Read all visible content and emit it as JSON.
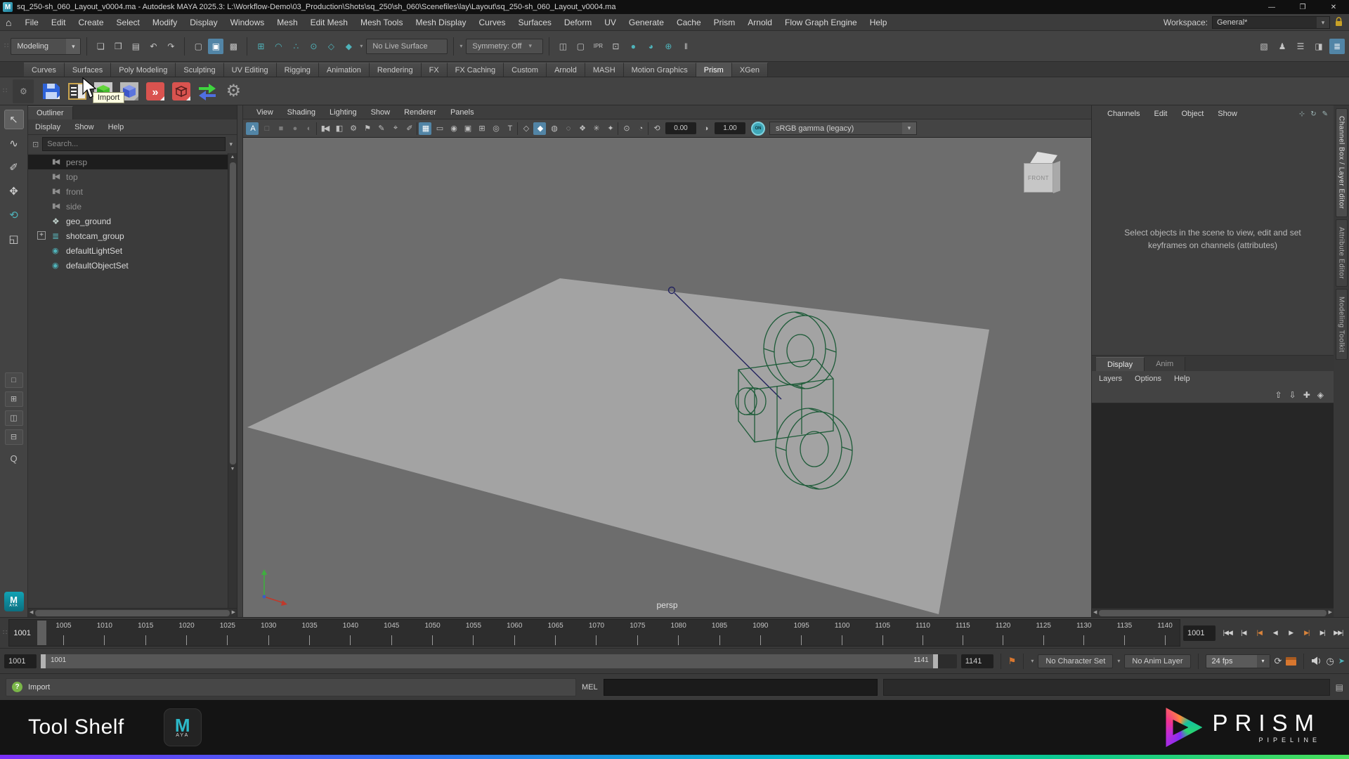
{
  "window": {
    "app_letter": "M",
    "title": "sq_250-sh_060_Layout_v0004.ma - Autodesk MAYA 2025.3: L:\\Workflow-Demo\\03_Production\\Shots\\sq_250\\sh_060\\Scenefiles\\lay\\Layout\\sq_250-sh_060_Layout_v0004.ma",
    "controls": {
      "minimize": "—",
      "maximize": "❐",
      "close": "✕"
    }
  },
  "glyphs": {
    "home": "⌂",
    "chevron_down": "▾",
    "handle": "∷",
    "gear": "⚙",
    "left_arrow": "◀",
    "right_arrow": "▶",
    "up_arrow": "▲",
    "down_arrow": "▼",
    "search_box": "⊡",
    "plus": "+",
    "question": "?",
    "bookmark": "⚑",
    "loop": "⟳",
    "clock": "◷",
    "run": "➤",
    "script": "▤",
    "lock": "lock"
  },
  "menubar": {
    "items": [
      "File",
      "Edit",
      "Create",
      "Select",
      "Modify",
      "Display",
      "Windows",
      "Mesh",
      "Edit Mesh",
      "Mesh Tools",
      "Mesh Display",
      "Curves",
      "Surfaces",
      "Deform",
      "UV",
      "Generate",
      "Cache",
      "Prism",
      "Arnold",
      "Flow Graph Engine",
      "Help"
    ],
    "workspace_label": "Workspace:",
    "workspace_value": "General*"
  },
  "toolbar": {
    "mode_selector": "Modeling",
    "file_icons": [
      {
        "name": "new-scene-icon",
        "glyph": "❏"
      },
      {
        "name": "open-scene-icon",
        "glyph": "❒"
      },
      {
        "name": "save-scene-icon",
        "glyph": "▤"
      },
      {
        "name": "undo-icon",
        "glyph": "↶"
      },
      {
        "name": "redo-icon",
        "glyph": "↷"
      }
    ],
    "select_icons": [
      {
        "name": "select-hierarchy-icon",
        "glyph": "▢"
      },
      {
        "name": "select-object-icon",
        "glyph": "▣",
        "active": true
      },
      {
        "name": "select-component-icon",
        "glyph": "▩"
      }
    ],
    "snap_icons": [
      {
        "name": "snap-to-grid-icon",
        "glyph": "⊞",
        "teal": true
      },
      {
        "name": "snap-to-curve-icon",
        "glyph": "◠",
        "teal": true
      },
      {
        "name": "snap-to-point-icon",
        "glyph": "∴",
        "teal": true
      },
      {
        "name": "snap-to-projected-center-icon",
        "glyph": "⊙",
        "teal": true
      },
      {
        "name": "snap-to-view-plane-icon",
        "glyph": "◇",
        "teal": true
      },
      {
        "name": "make-live-icon",
        "glyph": "◆",
        "teal": true
      }
    ],
    "no_live_surface": "No Live Surface",
    "symmetry": "Symmetry: Off",
    "render_icons": [
      {
        "name": "render-view-icon",
        "glyph": "◫"
      },
      {
        "name": "render-frame-icon",
        "glyph": "▢"
      },
      {
        "name": "ipr-render-icon",
        "glyph": "IPR",
        "small": true
      },
      {
        "name": "render-region-icon",
        "glyph": "⊡"
      },
      {
        "name": "render-current-frame-icon",
        "glyph": "●",
        "teal": true
      },
      {
        "name": "ipr-render-current-icon",
        "glyph": "◕",
        "teal": true
      },
      {
        "name": "render-sequence-icon",
        "glyph": "⊕",
        "teal": true
      },
      {
        "name": "pause-viewport-icon",
        "glyph": "‖"
      }
    ],
    "sidebar_icons": [
      {
        "name": "attribute-editor-toggle-icon",
        "glyph": "▧"
      },
      {
        "name": "tool-settings-toggle-icon",
        "glyph": "♟"
      },
      {
        "name": "channel-box-toggle-icon",
        "glyph": "☰"
      },
      {
        "name": "ui-elements-toggle-icon",
        "glyph": "◨"
      },
      {
        "name": "modeling-toolkit-toggle-icon",
        "glyph": "≣",
        "active": true
      }
    ]
  },
  "shelf": {
    "tabs": [
      {
        "label": "Curves"
      },
      {
        "label": "Surfaces"
      },
      {
        "label": "Poly Modeling"
      },
      {
        "label": "Sculpting"
      },
      {
        "label": "UV Editing"
      },
      {
        "label": "Rigging"
      },
      {
        "label": "Animation"
      },
      {
        "label": "Rendering"
      },
      {
        "label": "FX"
      },
      {
        "label": "FX Caching"
      },
      {
        "label": "Custom"
      },
      {
        "label": "Arnold"
      },
      {
        "label": "MASH"
      },
      {
        "label": "Motion Graphics"
      },
      {
        "label": "Prism",
        "active": true
      },
      {
        "label": "XGen"
      }
    ],
    "icon_names": [
      "prism-save-version-icon",
      "prism-project-browser-icon",
      "prism-import-icon",
      "prism-import-reference-icon",
      "prism-export-icon",
      "prism-export-selection-icon",
      "prism-update-icon",
      "prism-settings-icon"
    ],
    "tooltip": "Import"
  },
  "toolbox": {
    "tools": [
      {
        "name": "select-tool-icon",
        "glyph": "↖",
        "active": true
      },
      {
        "name": "lasso-tool-icon",
        "glyph": "∿"
      },
      {
        "name": "paint-select-tool-icon",
        "glyph": "✐"
      },
      {
        "name": "move-tool-icon",
        "glyph": "✥"
      },
      {
        "name": "rotate-tool-icon",
        "glyph": "⟲",
        "teal": true
      },
      {
        "name": "scale-tool-icon",
        "glyph": "◱"
      }
    ],
    "layouts": [
      {
        "name": "single-pane-layout-icon",
        "glyph": "□"
      },
      {
        "name": "four-pane-layout-icon",
        "glyph": "⊞"
      },
      {
        "name": "two-pane-layout-icon",
        "glyph": "◫"
      },
      {
        "name": "outliner-pane-layout-icon",
        "glyph": "⊟"
      }
    ],
    "zoom_label": "Q"
  },
  "outliner": {
    "tab": "Outliner",
    "menus": [
      "Display",
      "Show",
      "Help"
    ],
    "search_placeholder": "Search...",
    "items": [
      {
        "label": "persp",
        "glyph": "▮◀",
        "camera": true,
        "dim": true,
        "selected": true
      },
      {
        "label": "top",
        "glyph": "▮◀",
        "camera": true,
        "dim": true
      },
      {
        "label": "front",
        "glyph": "▮◀",
        "camera": true,
        "dim": true
      },
      {
        "label": "side",
        "glyph": "▮◀",
        "camera": true,
        "dim": true
      },
      {
        "label": "geo_ground",
        "glyph": "❖",
        "mesh": true
      },
      {
        "label": "shotcam_group",
        "glyph": "≣",
        "group": true,
        "expandable": true
      },
      {
        "label": "defaultLightSet",
        "glyph": "◉",
        "set": true
      },
      {
        "label": "defaultObjectSet",
        "glyph": "◉",
        "set": true
      }
    ]
  },
  "viewport": {
    "menus": [
      "View",
      "Shading",
      "Lighting",
      "Show",
      "Renderer",
      "Panels"
    ],
    "icons": [
      {
        "name": "renderer-a-icon",
        "glyph": "A",
        "active": true
      },
      {
        "name": "selection-outline-icon",
        "glyph": "□",
        "dim": true
      },
      {
        "name": "selection-fill-icon",
        "glyph": "■",
        "dim": true
      },
      {
        "name": "shading-ball-icon",
        "glyph": "●",
        "dim": true
      },
      {
        "name": "texture-ball-icon",
        "glyph": "◐",
        "dim": true
      },
      {
        "sep": true
      },
      {
        "name": "select-camera-icon",
        "glyph": "▮◀"
      },
      {
        "name": "lock-camera-icon",
        "glyph": "◧"
      },
      {
        "name": "camera-attributes-icon",
        "glyph": "⚙"
      },
      {
        "name": "bookmark-icon",
        "glyph": "⚑"
      },
      {
        "name": "grease-pencil-icon",
        "glyph": "✎"
      },
      {
        "name": "snap-zoom-icon",
        "glyph": "⌖",
        "teal": true
      },
      {
        "name": "annotate-icon",
        "glyph": "✐",
        "teal": true
      },
      {
        "sep": true
      },
      {
        "name": "grid-icon",
        "glyph": "▦",
        "active": true
      },
      {
        "name": "film-gate-icon",
        "glyph": "▭"
      },
      {
        "name": "resolution-gate-icon",
        "glyph": "◉"
      },
      {
        "name": "gate-mask-icon",
        "glyph": "▣"
      },
      {
        "name": "field-chart-icon",
        "glyph": "⊞"
      },
      {
        "name": "safe-action-icon",
        "glyph": "◎"
      },
      {
        "name": "safe-title-icon",
        "glyph": "T"
      },
      {
        "sep": true
      },
      {
        "name": "wireframe-icon",
        "glyph": "◇"
      },
      {
        "name": "smooth-shade-icon",
        "glyph": "◆",
        "active": true
      },
      {
        "name": "textured-icon",
        "glyph": "◍"
      },
      {
        "name": "use-default-material-icon",
        "glyph": "◌"
      },
      {
        "name": "wireframe-on-shaded-icon",
        "glyph": "❖"
      },
      {
        "name": "lighting-icon",
        "glyph": "✳"
      },
      {
        "name": "shadows-icon",
        "glyph": "✦"
      },
      {
        "sep": true
      },
      {
        "name": "isolate-select-icon",
        "glyph": "⊙"
      },
      {
        "name": "xray-icon",
        "glyph": "◔"
      },
      {
        "sep": true
      },
      {
        "name": "exposure-icon",
        "glyph": "⟲"
      }
    ],
    "exposure_value": "0.00",
    "contrast_icon": "◑",
    "gamma_value": "1.00",
    "on_toggle": "ON",
    "colorspace": "sRGB gamma (legacy)",
    "viewcube_face": "FRONT",
    "camera_label": "persp"
  },
  "channel_box": {
    "menus": [
      "Channels",
      "Edit",
      "Object",
      "Show"
    ],
    "corner_icons": [
      {
        "name": "snapshot-panel-icon",
        "glyph": "⊹"
      },
      {
        "name": "sync-panel-icon",
        "glyph": "↻"
      },
      {
        "name": "pin-panel-icon",
        "glyph": "✎"
      }
    ],
    "placeholder_message": "Select objects in the scene to view, edit and set keyframes on channels (attributes)"
  },
  "layer_editor": {
    "tabs": [
      {
        "label": "Display",
        "active": true
      },
      {
        "label": "Anim"
      }
    ],
    "menus": [
      "Layers",
      "Options",
      "Help"
    ],
    "icons": [
      {
        "name": "move-layer-up-icon",
        "glyph": "⇧"
      },
      {
        "name": "move-layer-down-icon",
        "glyph": "⇩"
      },
      {
        "name": "create-layer-from-selected-icon",
        "glyph": "✚"
      },
      {
        "name": "create-empty-layer-icon",
        "glyph": "◈"
      }
    ]
  },
  "side_tabs": [
    {
      "label": "Channel Box / Layer Editor",
      "active": true
    },
    {
      "label": "Attribute Editor"
    },
    {
      "label": "Modeling Toolkit"
    }
  ],
  "timeline": {
    "current_frame": "1001",
    "ticks": [
      "1005",
      "1010",
      "1015",
      "1020",
      "1025",
      "1030",
      "1035",
      "1040",
      "1045",
      "1050",
      "1055",
      "1060",
      "1065",
      "1070",
      "1075",
      "1080",
      "1085",
      "1090",
      "1095",
      "1100",
      "1105",
      "1110",
      "1115",
      "1120",
      "1125",
      "1130",
      "1135",
      "1140"
    ],
    "frame_field": "1001",
    "playback": [
      {
        "name": "go-to-start-icon",
        "glyph": "|◀◀"
      },
      {
        "name": "step-back-frame-icon",
        "glyph": "|◀"
      },
      {
        "name": "step-back-key-icon",
        "glyph": "|◀",
        "accent": true
      },
      {
        "name": "play-backward-icon",
        "glyph": "◀"
      },
      {
        "name": "play-forward-icon",
        "glyph": "▶"
      },
      {
        "name": "step-forward-key-icon",
        "glyph": "▶|",
        "accent": true
      },
      {
        "name": "step-forward-frame-icon",
        "glyph": "▶|"
      },
      {
        "name": "go-to-end-icon",
        "glyph": "▶▶|"
      }
    ]
  },
  "range": {
    "start_field": "1001",
    "bar_start": "1001",
    "bar_end": "1141",
    "end_field": "1141",
    "character_set": "No Character Set",
    "anim_layer": "No Anim Layer",
    "fps": "24 fps"
  },
  "command": {
    "help_text": "Import",
    "mel_label": "MEL"
  },
  "brand": {
    "tool_shelf": "Tool Shelf",
    "maya_m": "M",
    "maya_sub": "AYA",
    "prism": "PRISM",
    "prism_sub": "PIPELINE"
  }
}
